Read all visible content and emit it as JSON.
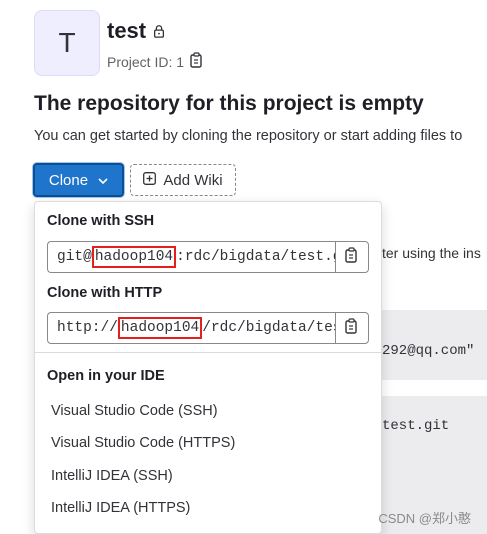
{
  "project": {
    "avatar_letter": "T",
    "name": "test",
    "id_label": "Project ID: 1"
  },
  "empty_state": {
    "title": "The repository for this project is empty",
    "text": "You can get started by cloning the repository or start adding files to"
  },
  "buttons": {
    "clone_label": "Clone",
    "add_wiki_label": "Add Wiki"
  },
  "background": {
    "text_instructions": "ter using the ins",
    "email_fragment": "292@qq.com\"",
    "git_fragment": "test.git"
  },
  "dropdown": {
    "ssh_label": "Clone with SSH",
    "ssh_url_prefix": "git@",
    "ssh_url_host": "hadoop104",
    "ssh_url_suffix": ":rdc/bigdata/test.git",
    "http_label": "Clone with HTTP",
    "http_url_prefix": "http://",
    "http_url_host": "hadoop104",
    "http_url_suffix": "/rdc/bigdata/test.git",
    "ide_heading": "Open in your IDE",
    "ide_items": [
      "Visual Studio Code (SSH)",
      "Visual Studio Code (HTTPS)",
      "IntelliJ IDEA (SSH)",
      "IntelliJ IDEA (HTTPS)"
    ]
  },
  "watermark": "CSDN @郑小憨",
  "colors": {
    "primary": "#1f75cb",
    "highlight_box": "#e3201d",
    "avatar_bg": "#eeeefe"
  }
}
